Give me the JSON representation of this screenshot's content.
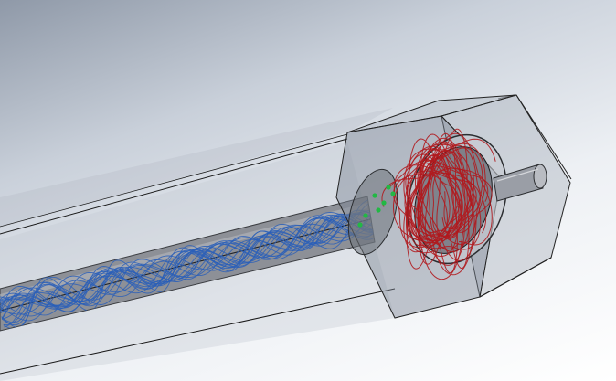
{
  "viewport": {
    "background_top": "#8f99a8",
    "background_bottom": "#ffffff"
  },
  "model": {
    "duct_fill": "#c3c8d0",
    "duct_edge": "#000000",
    "pipe_fill": "#8d9097",
    "housing_fill": "#7d8594",
    "chamber_fill": "#5e6068",
    "shaft_fill": "#9a9ea6"
  },
  "flow_trajectories": {
    "outer_color": "#2a5fb8",
    "inner_color": "#b0191e",
    "marker_color": "#22b844"
  }
}
